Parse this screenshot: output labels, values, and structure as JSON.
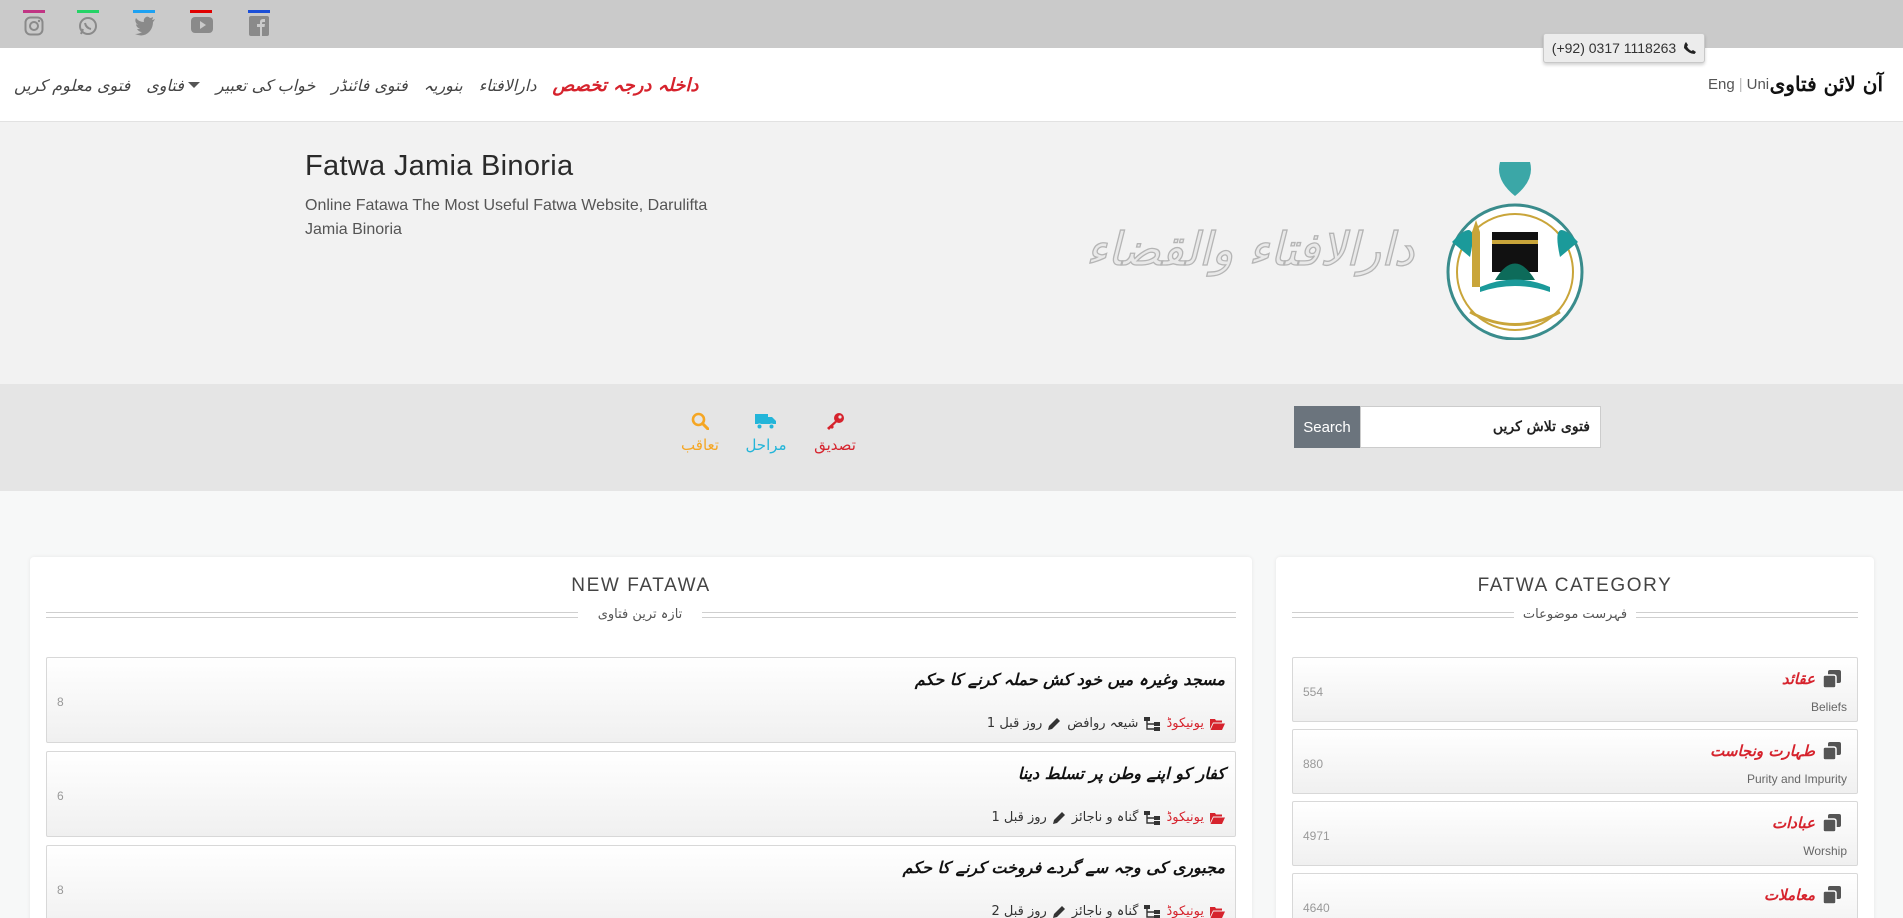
{
  "topbar": {
    "social": [
      {
        "name": "instagram",
        "icon": "instagram-icon",
        "color": "#c13584"
      },
      {
        "name": "whatsapp",
        "icon": "whatsapp-icon",
        "color": "#25d366"
      },
      {
        "name": "twitter",
        "icon": "twitter-icon",
        "color": "#1da1f2"
      },
      {
        "name": "youtube",
        "icon": "youtube-icon",
        "color": "#e00000"
      },
      {
        "name": "facebook",
        "icon": "facebook-icon",
        "color": "#1b4fd8"
      }
    ],
    "phone": "(+92) 0317 1118263"
  },
  "nav": {
    "brand": "آن لائن فتاوی",
    "lang_en": "Eng",
    "lang_sep": "|",
    "lang_uni": "Uni",
    "items": [
      {
        "label": "داخلہ درجہ تخصص",
        "highlight": true
      },
      {
        "label": "دارالافتاء"
      },
      {
        "label": "بنوریہ"
      },
      {
        "label": "فتوی فائنڈر"
      },
      {
        "label": "خواب کی تعبیر"
      },
      {
        "label": "فتاوی",
        "dropdown": true
      },
      {
        "label": "فتوی معلوم کریں"
      }
    ]
  },
  "hero": {
    "title": "Fatwa Jamia Binoria",
    "subtitle": "Online Fatawa The Most Useful Fatwa Website, Darulifta Jamia Binoria",
    "logo_calligraphy": "دارالافتاء والقضاء"
  },
  "search": {
    "placeholder": "فتوی تلاش کریں",
    "button": "Search",
    "actions": [
      {
        "label": "تصدیق",
        "icon": "key-icon",
        "color": "#d6232d"
      },
      {
        "label": "مراحل",
        "icon": "truck-icon",
        "color": "#23b5d9"
      },
      {
        "label": "تعاقب",
        "icon": "search-icon",
        "color": "#f5a623"
      }
    ]
  },
  "new_fatawa": {
    "title": "NEW FATAWA",
    "subtitle": "تازہ ترین فتاوی",
    "items": [
      {
        "title": "مسجد وغیرہ میں خود کش حملہ کرنے کا حکم",
        "category": "یونیکوڈ",
        "tag": "شیعہ روافض",
        "time": "1 روز قبل",
        "count": "8"
      },
      {
        "title": "کفار کو اپنے وطن پر تسلط دینا",
        "category": "یونیکوڈ",
        "tag": "گناہ و ناجائز",
        "time": "1 روز قبل",
        "count": "6"
      },
      {
        "title": "مجبوری کی وجہ سے گردے فروخت کرنے کا حکم",
        "category": "یونیکوڈ",
        "tag": "گناہ و ناجائز",
        "time": "2 روز قبل",
        "count": "8"
      }
    ]
  },
  "categories": {
    "title": "FATWA CATEGORY",
    "subtitle": "فہرست موضوعات",
    "items": [
      {
        "label": "عقائد",
        "en": "Beliefs",
        "count": "554"
      },
      {
        "label": "طہارت ونجاست",
        "en": "Purity and Impurity",
        "count": "880"
      },
      {
        "label": "عبادات",
        "en": "Worship",
        "count": "4971"
      },
      {
        "label": "معاملات",
        "en": "",
        "count": "4640"
      }
    ]
  },
  "colors": {
    "accent": "#d6232d",
    "search_button": "#6b747d"
  }
}
